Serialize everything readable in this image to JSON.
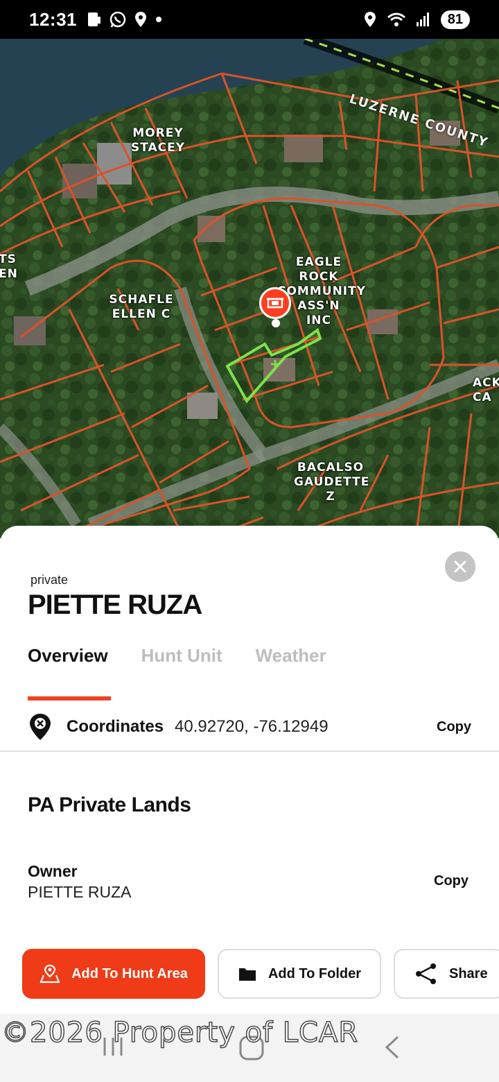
{
  "status_bar": {
    "time": "12:31",
    "battery": "81",
    "icons": [
      "sim-icon",
      "whatsapp-icon",
      "location-icon",
      "dot-icon",
      "location-icon",
      "wifi-icon",
      "signal-icon"
    ]
  },
  "map": {
    "county_label": "LUZERNE COUNTY",
    "parcel_labels": [
      {
        "lines": [
          "MOREY",
          "STACEY"
        ]
      },
      {
        "lines": [
          "TS",
          "EN"
        ]
      },
      {
        "lines": [
          "SCHAFLE",
          "ELLEN C"
        ]
      },
      {
        "lines": [
          "EAGLE",
          "ROCK",
          "COMMUNITY",
          "ASS'N",
          "INC"
        ]
      },
      {
        "lines": [
          "ACK",
          "CA"
        ]
      },
      {
        "lines": [
          "BACALSO",
          "GAUDETTE",
          "Z"
        ]
      }
    ],
    "parcel_line_color": "#d9532a",
    "selected_parcel_color": "#7fe04a",
    "pin_color": "#ff3d1f"
  },
  "sheet": {
    "category": "private",
    "title": "PIETTE RUZA",
    "tabs": [
      {
        "label": "Overview",
        "active": true
      },
      {
        "label": "Hunt Unit",
        "active": false
      },
      {
        "label": "Weather",
        "active": false
      }
    ],
    "coordinates": {
      "label": "Coordinates",
      "value": "40.92720, -76.12949",
      "copy": "Copy"
    },
    "section_title": "PA Private Lands",
    "owner": {
      "label": "Owner",
      "value": "PIETTE RUZA",
      "copy": "Copy"
    },
    "actions": {
      "add_hunt_area": "Add To Hunt Area",
      "add_folder": "Add To Folder",
      "share": "Share"
    },
    "accent_color": "#ef3b17"
  },
  "watermark": "©2026 Property of LCAR"
}
